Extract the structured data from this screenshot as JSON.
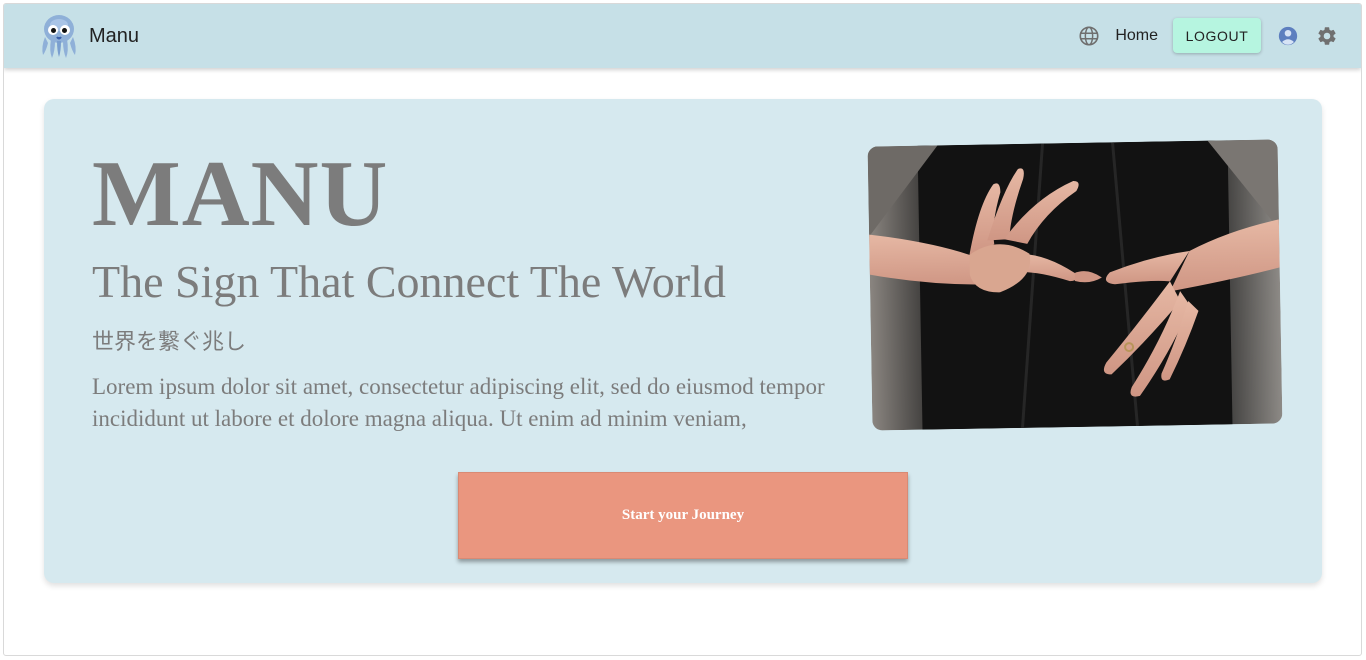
{
  "appbar": {
    "brand_name": "Manu",
    "home_label": "Home",
    "logout_label": "LOGOUT",
    "icons": {
      "language": "globe-icon",
      "account": "account-circle-icon",
      "settings": "gear-icon"
    }
  },
  "hero": {
    "title": "MANU",
    "subtitle": "The Sign That Connect The World",
    "subtitle_jp": "世界を繋ぐ兆し",
    "body": "Lorem ipsum dolor sit amet, consectetur adipiscing elit, sed do eiusmod tempor incididunt ut labore et dolore magna aliqua. Ut enim ad minim veniam,",
    "cta_label": "Start your Journey"
  },
  "colors": {
    "appbar_bg": "#c6e0e7",
    "hero_bg": "#d6e9ef",
    "logout_bg": "#b6f5e0",
    "cta_bg": "#ea967f",
    "text_gray": "#7c7c7c"
  }
}
